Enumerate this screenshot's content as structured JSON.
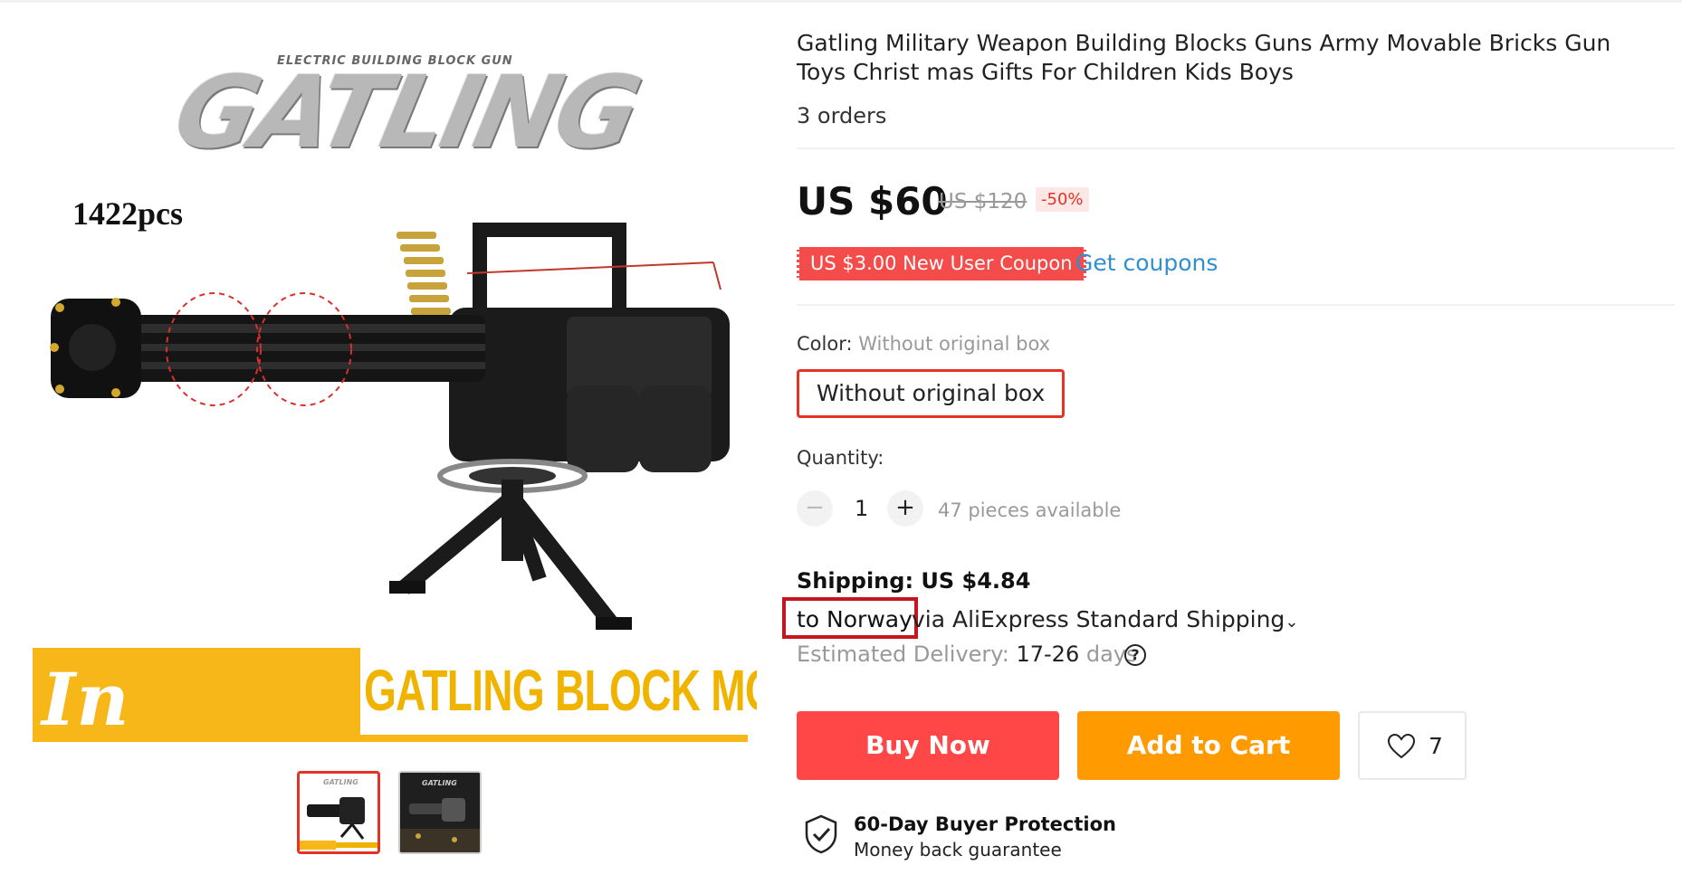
{
  "gallery": {
    "logo_subtitle": "ELECTRIC BUILDING BLOCK GUN",
    "logo_text": "GATLING",
    "piece_count": "1422pcs",
    "banner_left": "In Stock",
    "banner_right": "GATLING BLOCK MODEL",
    "thumb_caption": "GATLING"
  },
  "product": {
    "title": "Gatling Military Weapon Building Blocks Guns Army Movable Bricks Gun Toys Christ mas Gifts For Children Kids Boys",
    "orders": "3 orders",
    "price": "US $60",
    "original_price": "US $120",
    "discount": "-50%"
  },
  "coupon": {
    "label": "US $3.00 New User Coupon",
    "link": "Get coupons"
  },
  "color": {
    "label": "Color:",
    "selected_value": "Without original box",
    "option_label": "Without original box"
  },
  "quantity": {
    "label": "Quantity:",
    "minus": "−",
    "value": "1",
    "plus": "+",
    "available": "47 pieces available"
  },
  "shipping": {
    "title": "Shipping: US $4.84",
    "destination": "to Norway",
    "method": "via AliExpress Standard Shipping",
    "chevron": "⌄",
    "delivery_label": "Estimated Delivery:",
    "delivery_days": "17-26",
    "delivery_unit": "days",
    "help": "?"
  },
  "actions": {
    "buy_now": "Buy Now",
    "add_to_cart": "Add to Cart",
    "wishlist_count": "7"
  },
  "protection": {
    "title": "60-Day Buyer Protection",
    "subtitle": "Money back guarantee"
  },
  "colors": {
    "accent_red": "#ff4747",
    "coupon_red": "#f44b4b",
    "cart_orange": "#ff9a00",
    "link_blue": "#2f8fd0",
    "highlight_box": "#c4161c",
    "banner_yellow": "#f7b718"
  }
}
